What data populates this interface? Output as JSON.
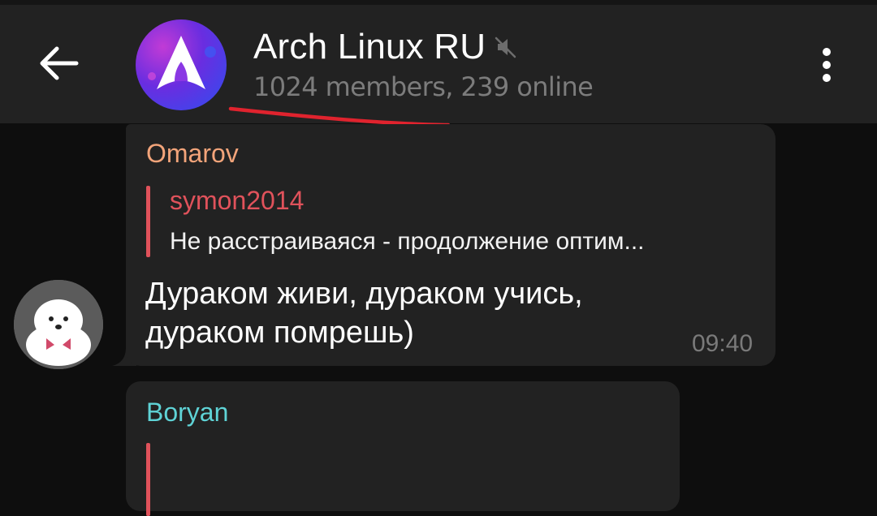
{
  "header": {
    "back_icon": "arrow-left-icon",
    "title": "Arch Linux RU",
    "muted_icon": "muted-speaker-icon",
    "subtitle": "1024 members, 239 online",
    "menu_icon": "more-vertical-icon",
    "avatar_icon": "arch-linux-logo",
    "annotation_color": "#e0232e"
  },
  "messages": [
    {
      "sender": "Omarov",
      "sender_color": "#f2a47a",
      "reply_to": {
        "author": "symon2014",
        "text": "Не расстраиваяся - продолжение оптим..."
      },
      "text_lines": [
        "Дураком живи, дураком учись,",
        "дураком помрешь)"
      ],
      "time": "09:40"
    },
    {
      "sender": "Boryan",
      "sender_color": "#5fd3d6"
    }
  ],
  "colors": {
    "background": "#0e0e0e",
    "header_bg": "#222222",
    "bubble_bg": "#222222",
    "quote_accent": "#e0525b"
  }
}
